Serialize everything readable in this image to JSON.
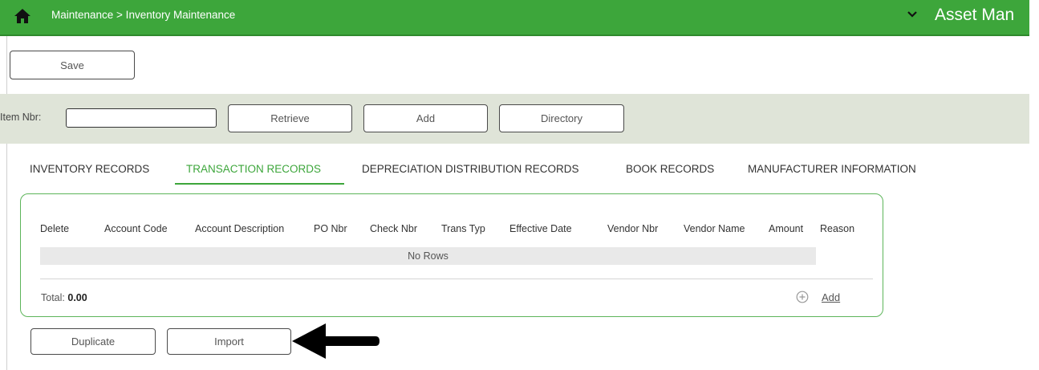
{
  "header": {
    "breadcrumb": "Maintenance > Inventory Maintenance",
    "app_name": "Asset Man",
    "bg_color": "#3da63b"
  },
  "toolbar": {
    "save_label": "Save"
  },
  "filter": {
    "item_label": "Item Nbr:",
    "item_value": "",
    "retrieve_label": "Retrieve",
    "add_label": "Add",
    "directory_label": "Directory"
  },
  "tabs": [
    {
      "label": "INVENTORY RECORDS",
      "active": false
    },
    {
      "label": "TRANSACTION RECORDS",
      "active": true
    },
    {
      "label": "DEPRECIATION DISTRIBUTION RECORDS",
      "active": false
    },
    {
      "label": "BOOK RECORDS",
      "active": false
    },
    {
      "label": "MANUFACTURER INFORMATION",
      "active": false
    }
  ],
  "table": {
    "columns": [
      "Delete",
      "Account Code",
      "Account Description",
      "PO Nbr",
      "Check Nbr",
      "Trans Typ",
      "Effective Date",
      "Vendor Nbr",
      "Vendor Name",
      "Amount",
      "Reason"
    ],
    "empty_text": "No Rows",
    "total_label": "Total:",
    "total_value": "0.00",
    "add_link": "Add"
  },
  "actions": {
    "duplicate_label": "Duplicate",
    "import_label": "Import"
  },
  "accent_color": "#3da63b"
}
